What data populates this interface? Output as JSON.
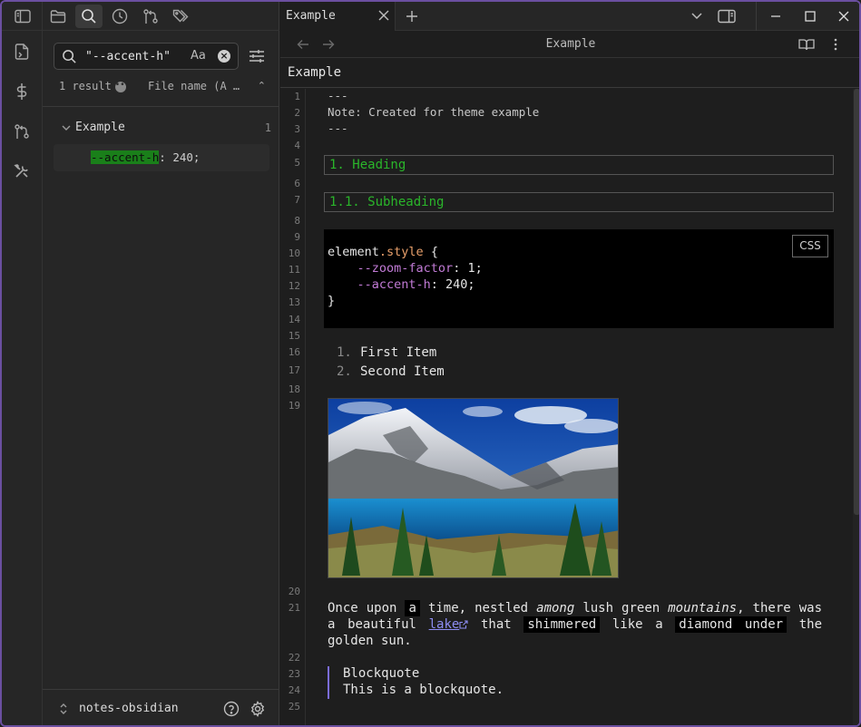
{
  "ribbon": {
    "icons": [
      "sidebar-toggle-icon",
      "file-plus-icon",
      "dollar-icon",
      "git-branch-icon",
      "tools-icon"
    ]
  },
  "sidebar": {
    "tab_icons": [
      "folder-icon",
      "search-icon",
      "clock-icon",
      "git-compare-icon",
      "tags-icon"
    ],
    "search": {
      "value": "\"--accent-h\"",
      "match_case_label": "Aa"
    },
    "result_count": "1 result",
    "sort_label": "File name (A …",
    "result_file": {
      "name": "Example",
      "count": "1",
      "match_highlight": "--accent-h",
      "match_rest": ": 240;"
    },
    "vault_name": "notes-obsidian"
  },
  "tabbar": {
    "tab_label": "Example"
  },
  "navbar": {
    "title": "Example"
  },
  "inline_title": "Example",
  "editor": {
    "line_numbers": [
      "1",
      "2",
      "3",
      "4",
      "5",
      "6",
      "7",
      "8",
      "9",
      "10",
      "11",
      "12",
      "13",
      "14",
      "15",
      "16",
      "17",
      "18",
      "19",
      "20",
      "21",
      "22",
      "23",
      "24",
      "25"
    ],
    "frontmatter": {
      "open": "---",
      "note": "Note: Created for theme example",
      "close": "---"
    },
    "heading1": "1. Heading",
    "heading2": "1.1. Subheading",
    "code": {
      "language_label": "CSS",
      "selector_element": "element",
      "selector_dot": ".",
      "selector_prop": "style",
      "open_brace": " {",
      "l2_var": "--zoom-factor",
      "l2_rest": ": 1;",
      "l3_var": "--accent-h",
      "l3_rest": ": 240;",
      "close_brace": "}"
    },
    "list": [
      {
        "num": "1.",
        "text": "First Item"
      },
      {
        "num": "2.",
        "text": "Second Item"
      }
    ],
    "paragraph": {
      "p1": "Once upon ",
      "mark1": "a",
      "p2": " time, nestled ",
      "em1": "among",
      "p3": " lush green ",
      "em2": "mountains",
      "p4": ", there was a beautiful ",
      "link": "lake",
      "p5": " that ",
      "mark2": "shimmered",
      "p6": " like a ",
      "mark3": "diamond under",
      "p7": " the golden sun."
    },
    "blockquote": {
      "line1": "Blockquote",
      "line2": "This is a blockquote."
    }
  },
  "colors": {
    "accent": "#7b6cd9",
    "heading": "#2ab52a",
    "search_highlight": "#1a7f1a",
    "frame_border": "#6b4fa0"
  }
}
